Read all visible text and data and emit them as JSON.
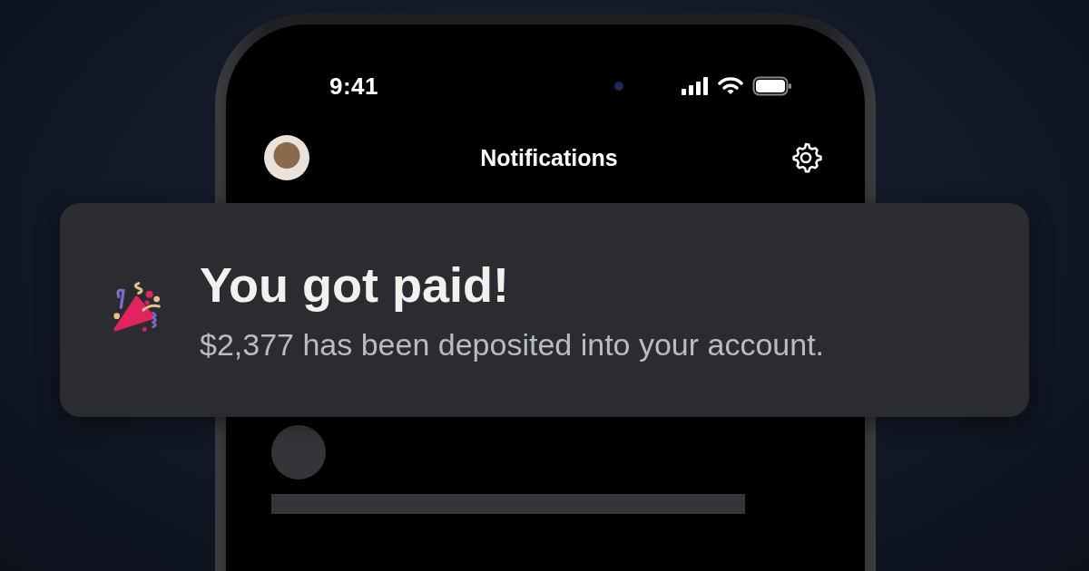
{
  "status_bar": {
    "time": "9:41"
  },
  "header": {
    "title": "Notifications"
  },
  "notification": {
    "title": "You got paid!",
    "message": "$2,377 has been deposited into your account."
  }
}
